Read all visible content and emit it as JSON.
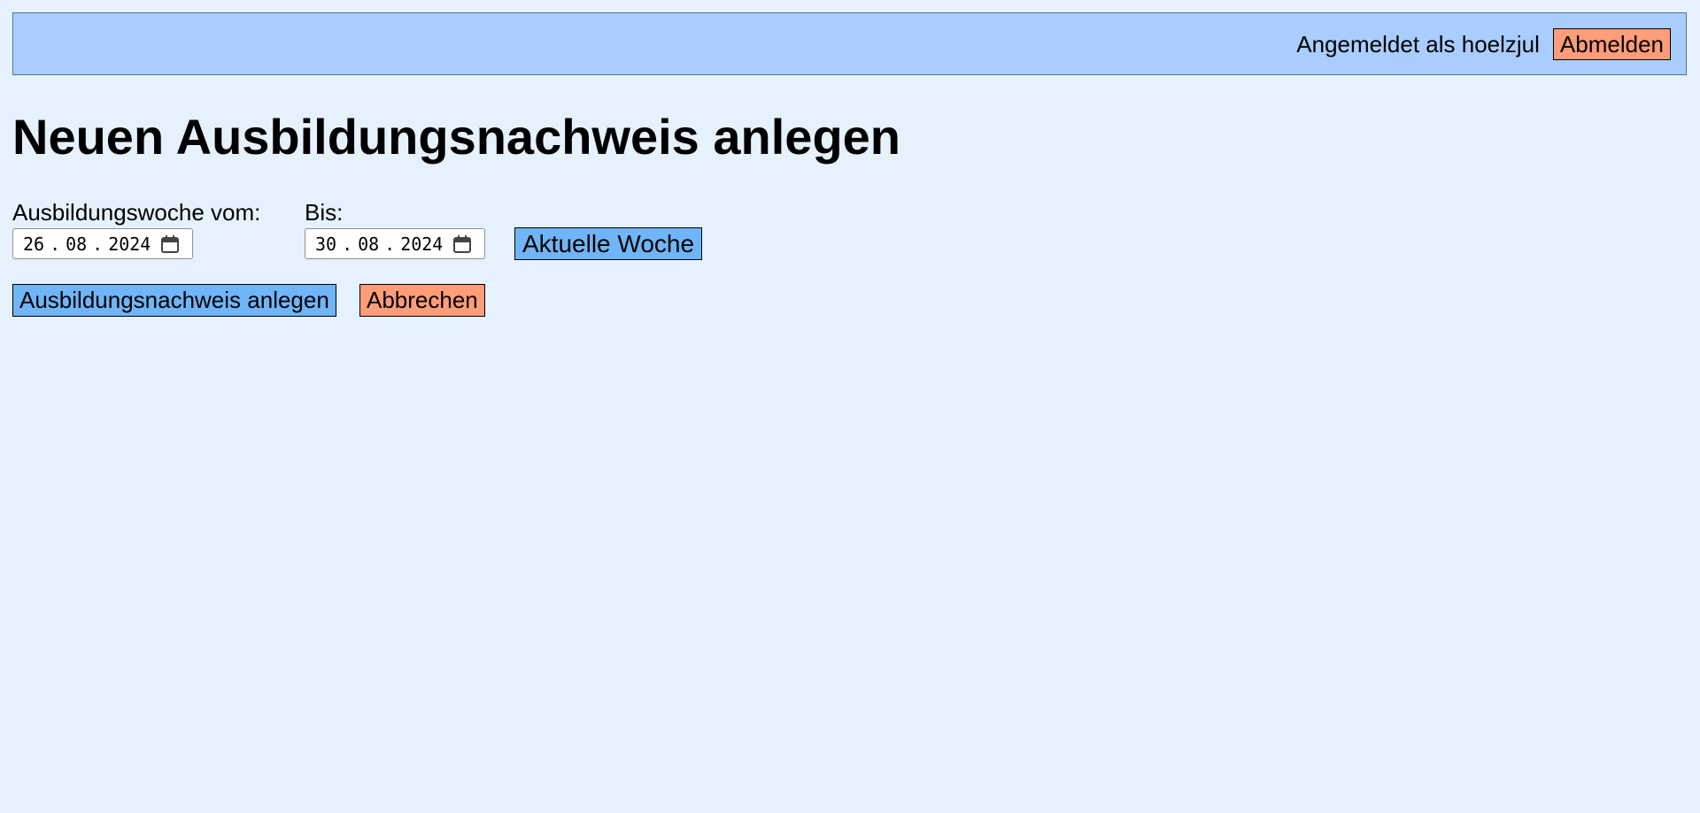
{
  "header": {
    "logged_in_text": "Angemeldet als hoelzjul",
    "logout_label": "Abmelden"
  },
  "page": {
    "title": "Neuen Ausbildungsnachweis anlegen"
  },
  "form": {
    "from": {
      "label": "Ausbildungswoche vom:",
      "day": "26",
      "month": "08",
      "year": "2024",
      "separator": "."
    },
    "to": {
      "label": "Bis:",
      "day": "30",
      "month": "08",
      "year": "2024",
      "separator": "."
    },
    "current_week_label": "Aktuelle Woche",
    "create_label": "Ausbildungsnachweis anlegen",
    "cancel_label": "Abbrechen"
  },
  "icons": {
    "date_picker": "calendar-icon"
  },
  "colors": {
    "page_background": "#e6f1fe",
    "header_background": "#a8cdfe",
    "primary_button": "#6fb5f7",
    "danger_button": "#ff9c79"
  }
}
